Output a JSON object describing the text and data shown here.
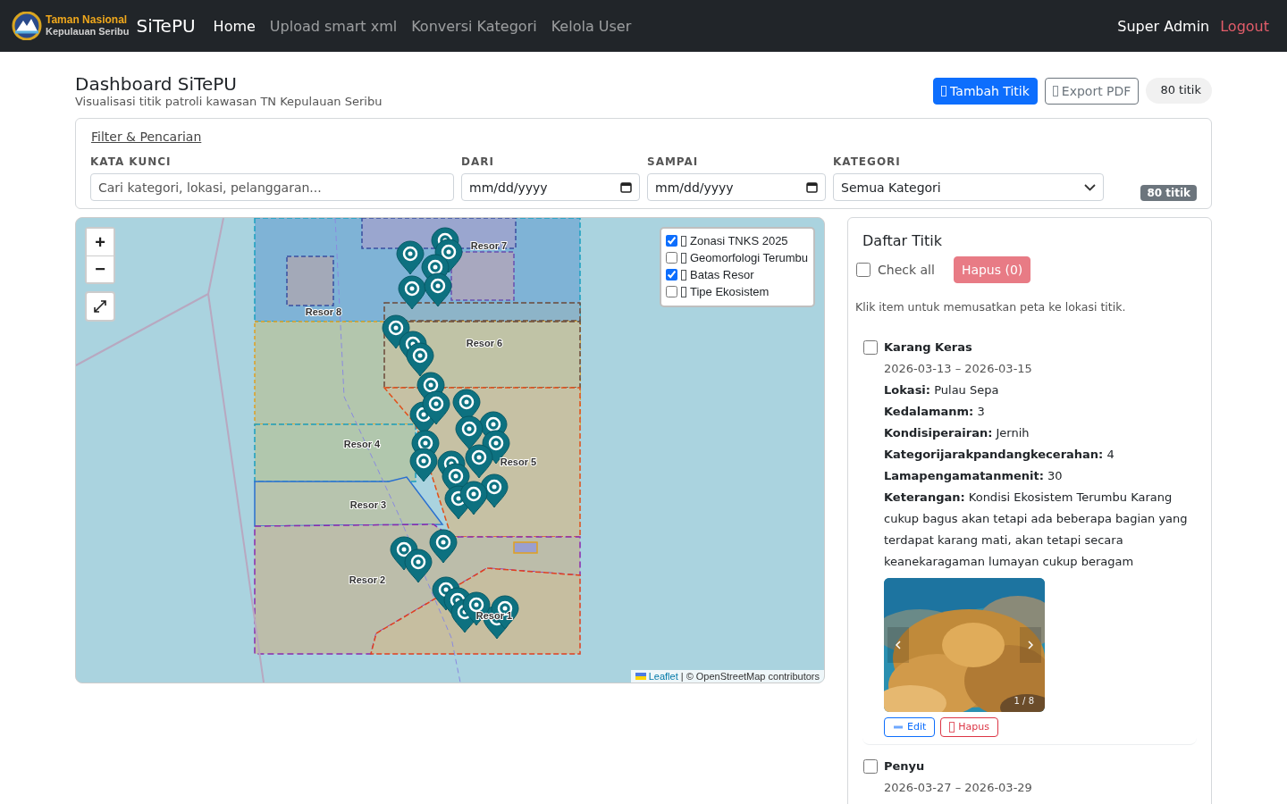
{
  "navbar": {
    "logo_lines": [
      "Taman Nasional",
      "Kepulauan Seribu"
    ],
    "brand": "SiTePU",
    "links": [
      {
        "label": "Home",
        "selected": true
      },
      {
        "label": "Upload smart xml",
        "selected": false
      },
      {
        "label": "Konversi Kategori",
        "selected": false
      },
      {
        "label": "Kelola User",
        "selected": false
      }
    ],
    "user": "Super Admin",
    "logout": "Logout"
  },
  "header": {
    "title": "Dashboard SiTePU",
    "subtitle": "Visualisasi titik patroli kawasan TN Kepulauan Seribu",
    "add_button": "Tambah Titik",
    "export_button": "Export PDF",
    "count": "80 titik"
  },
  "filter": {
    "toggle": "Filter & Pencarian",
    "fields": [
      {
        "kind": "text",
        "label": "KATA KUNCI",
        "placeholder": "Cari kategori, lokasi, pelanggaran..."
      },
      {
        "kind": "date",
        "label": "DARI",
        "value": "mm/dd/yyyy"
      },
      {
        "kind": "date",
        "label": "SAMPAI",
        "value": "mm/dd/yyyy"
      },
      {
        "kind": "select",
        "label": "KATEGORI",
        "value": "Semua Kategori"
      }
    ],
    "badge": "80 titik"
  },
  "map": {
    "zoom_in": "+",
    "zoom_out": "−",
    "layers": [
      {
        "label": "Zonasi TNKS 2025",
        "checked": true
      },
      {
        "label": "Geomorfologi Terumbu",
        "checked": false
      },
      {
        "label": "Batas Resor",
        "checked": true
      },
      {
        "label": "Tipe Ekosistem",
        "checked": false
      }
    ],
    "zone_labels": [
      "Resor 7",
      "Resor 8",
      "Resor 6",
      "Resor 4",
      "Resor 5",
      "Resor 3",
      "Resor 2",
      "Resor 1"
    ],
    "attribution": {
      "link": "Leaflet",
      "text": "| © OpenStreetMap contributors"
    }
  },
  "list": {
    "title": "Daftar Titik",
    "check_all": {
      "label": "Check all",
      "checked": false
    },
    "delete_button": {
      "label": "Hapus (0)",
      "disabled": true
    },
    "hint": "Klik item untuk memusatkan peta ke lokasi titik.",
    "items": [
      {
        "title": "Karang Keras",
        "checked": false,
        "dates": "2026-03-13 – 2026-03-15",
        "details": [
          "**Lokasi:** Pulau Sepa",
          "**Kedalamanm:** 3",
          "**Kondisiperairan:** Jernih",
          "**Kategorijarakpandangkecerahan:** 4",
          "**Lamapengamatanmenit:** 30",
          "**Keterangan:** Kondisi Ekosistem Terumbu Karang cukup bagus akan tetapi ada beberapa bagian yang terdapat karang mati, akan tetapi secara keanekaragaman lumayan cukup beragam"
        ],
        "photo": {
          "kind": "picture",
          "counter": "1 / 8"
        },
        "edit": "Edit",
        "delete": "Hapus"
      },
      {
        "title": "Penyu",
        "checked": false,
        "dates": "2026-03-27 – 2026-03-29"
      }
    ]
  }
}
